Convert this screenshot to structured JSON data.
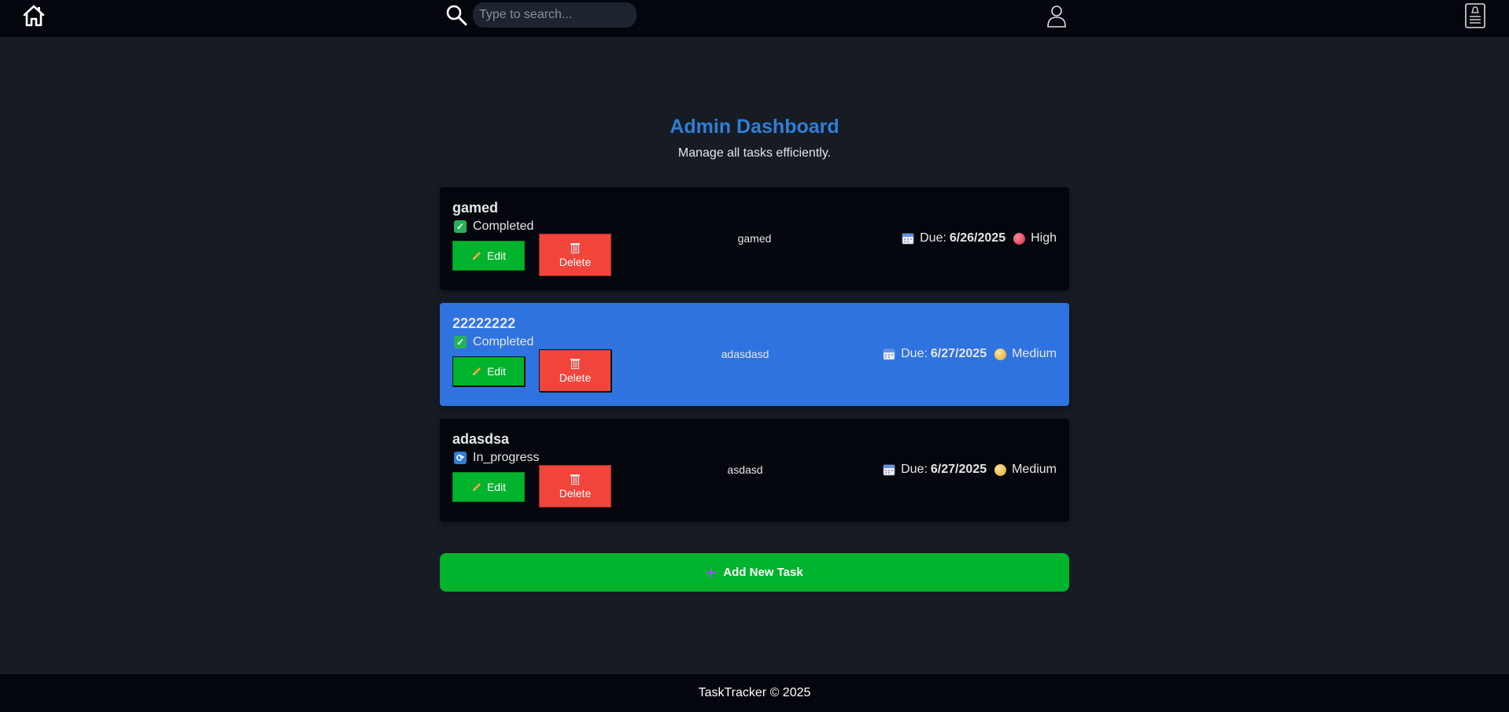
{
  "nav": {
    "home_icon": "home-icon",
    "search_icon": "search-icon",
    "search_placeholder": "Type to search...",
    "search_value": "",
    "user_icon": "user-icon",
    "notes_icon": "notes-icon"
  },
  "header": {
    "title": "Admin Dashboard",
    "subtitle": "Manage all tasks efficiently."
  },
  "tasks": [
    {
      "title": "gamed",
      "status": "Completed",
      "status_icon": "check-icon",
      "description": "gamed",
      "due_label": "Due:",
      "due_date": "6/26/2025",
      "priority": "High",
      "priority_color": "#d8263e",
      "edit_label": "Edit",
      "delete_label": "Delete",
      "highlighted": false
    },
    {
      "title": "22222222",
      "status": "Completed",
      "status_icon": "check-icon",
      "description": "adasdasd",
      "due_label": "Due:",
      "due_date": "6/27/2025",
      "priority": "Medium",
      "priority_color": "#e0a72a",
      "edit_label": "Edit",
      "delete_label": "Delete",
      "highlighted": true
    },
    {
      "title": "adasdsa",
      "status": "In_progress",
      "status_icon": "refresh-icon",
      "description": "asdasd",
      "due_label": "Due:",
      "due_date": "6/27/2025",
      "priority": "Medium",
      "priority_color": "#e0a72a",
      "edit_label": "Edit",
      "delete_label": "Delete",
      "highlighted": false
    }
  ],
  "add_task": {
    "label": "Add New Task"
  },
  "footer": {
    "text": "TaskTracker © 2025"
  },
  "colors": {
    "accent": "#2f7fd6",
    "success": "#00b32c",
    "danger": "#f1443b",
    "highlight_card": "#2e73df",
    "background": "#161b24",
    "bar": "#03060d"
  }
}
